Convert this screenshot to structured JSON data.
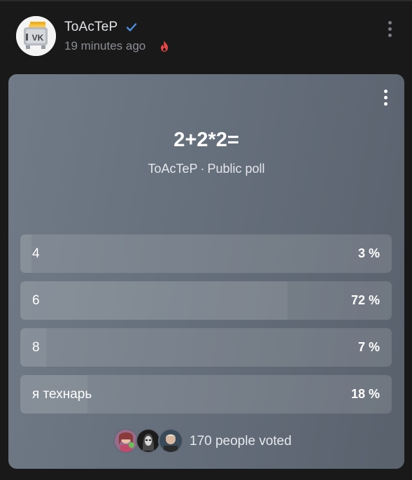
{
  "post": {
    "author": "ToAcTeP",
    "time": "19 minutes ago",
    "icons": {
      "avatar": "vk-toaster-avatar",
      "verified": "checkmark-icon",
      "trending": "fire-icon",
      "menu": "more-vertical-icon"
    },
    "colors": {
      "verified": "#4a8fe0",
      "fire": "#e64646"
    }
  },
  "poll": {
    "title": "2+2*2=",
    "author": "ToAcTeP",
    "separator": "·",
    "type": "Public poll",
    "options": [
      {
        "label": "4",
        "percent_text": "3 %",
        "percent": 3
      },
      {
        "label": "6",
        "percent_text": "72 %",
        "percent": 72
      },
      {
        "label": "8",
        "percent_text": "7 %",
        "percent": 7
      },
      {
        "label": "я технарь",
        "percent_text": "18 %",
        "percent": 18
      }
    ],
    "voters_text": "170 people voted",
    "menu_icon": "more-vertical-icon"
  }
}
